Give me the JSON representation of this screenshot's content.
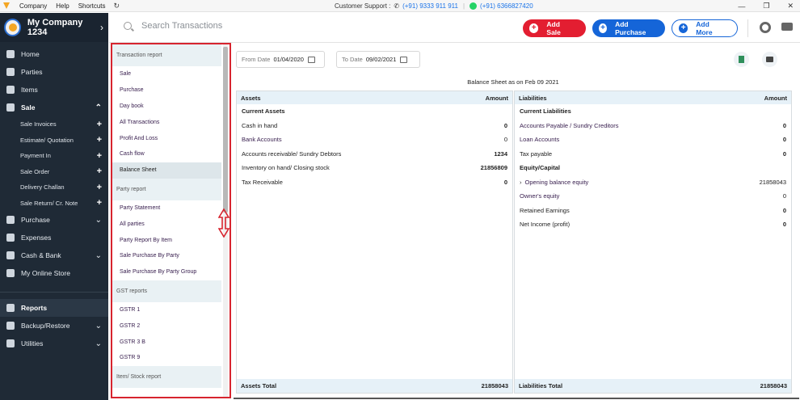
{
  "topbar": {
    "menu": [
      "Company",
      "Help",
      "Shortcuts"
    ],
    "support_label": "Customer Support :",
    "phone1": "(+91) 9333 911 911",
    "phone2": "(+91) 6366827420"
  },
  "sidebar": {
    "company_name": "My Company 1234",
    "items": [
      {
        "label": "Home",
        "icon": "home-icon"
      },
      {
        "label": "Parties",
        "icon": "parties-icon"
      },
      {
        "label": "Items",
        "icon": "items-icon"
      },
      {
        "label": "Sale",
        "icon": "sale-icon"
      }
    ],
    "sale_sub": [
      "Sale Invoices",
      "Estimate/ Quotation",
      "Payment In",
      "Sale Order",
      "Delivery Challan",
      "Sale Return/ Cr. Note"
    ],
    "items2": [
      {
        "label": "Purchase",
        "icon": "purchase-icon"
      },
      {
        "label": "Expenses",
        "icon": "expenses-icon"
      },
      {
        "label": "Cash & Bank",
        "icon": "bank-icon"
      },
      {
        "label": "My Online Store",
        "icon": "store-icon"
      }
    ],
    "items3": [
      {
        "label": "Reports",
        "icon": "reports-icon"
      },
      {
        "label": "Backup/Restore",
        "icon": "backup-icon"
      },
      {
        "label": "Utilities",
        "icon": "utilities-icon"
      }
    ]
  },
  "header": {
    "search_placeholder": "Search Transactions",
    "add_sale": "Add Sale",
    "add_purchase": "Add Purchase",
    "add_more": "Add More"
  },
  "report_nav": {
    "transaction_header": "Transaction report",
    "transaction_items": [
      "Sale",
      "Purchase",
      "Day book",
      "All Transactions",
      "Profit And Loss",
      "Cash flow",
      "Balance Sheet"
    ],
    "party_header": "Party report",
    "party_items": [
      "Party Statement",
      "All parties",
      "Party Report By Item",
      "Sale Purchase By Party",
      "Sale Purchase By Party Group"
    ],
    "gst_header": "GST reports",
    "gst_items": [
      "GSTR 1",
      "GSTR 2",
      "GSTR 3 B",
      "GSTR 9"
    ],
    "stock_header": "Item/ Stock report"
  },
  "filters": {
    "from_label": "From Date",
    "from_value": "01/04/2020",
    "to_label": "To Date",
    "to_value": "09/02/2021"
  },
  "balance_sheet": {
    "title": "Balance Sheet as on Feb 09 2021",
    "assets_header": "Assets",
    "amount_header": "Amount",
    "current_assets": "Current Assets",
    "assets_rows": [
      {
        "label": "Cash in hand",
        "value": "0"
      },
      {
        "label": "Bank Accounts",
        "value": "0"
      },
      {
        "label": "Accounts receivable/ Sundry Debtors",
        "value": "1234"
      },
      {
        "label": "Inventory on hand/ Closing stock",
        "value": "21856809"
      },
      {
        "label": "Tax Receivable",
        "value": "0"
      }
    ],
    "assets_total_label": "Assets Total",
    "assets_total": "21858043",
    "liab_header": "Liabilities",
    "current_liab": "Current Liabilities",
    "liab_rows": [
      {
        "label": "Accounts Payable / Sundry Creditors",
        "value": "0"
      },
      {
        "label": "Loan Accounts",
        "value": "0"
      },
      {
        "label": "Tax payable",
        "value": "0"
      }
    ],
    "equity_header": "Equity/Capital",
    "equity_rows": [
      {
        "label": "Opening balance equity",
        "value": "21858043"
      },
      {
        "label": "Owner's equity",
        "value": "0"
      },
      {
        "label": "Retained Earnings",
        "value": "0"
      },
      {
        "label": "Net Income (profit)",
        "value": "0"
      }
    ],
    "liab_total_label": "Liabilities Total",
    "liab_total": "21858043"
  }
}
